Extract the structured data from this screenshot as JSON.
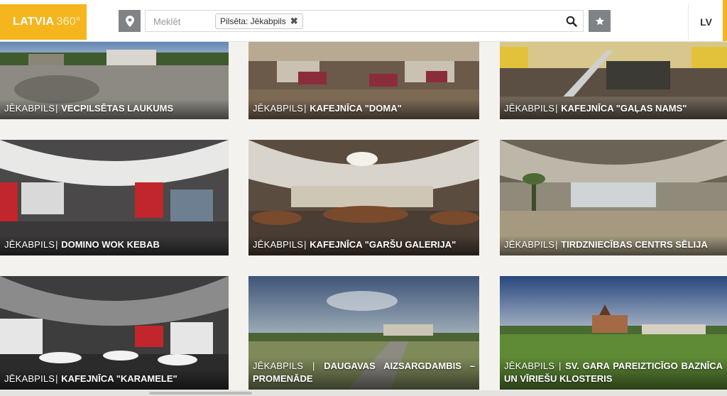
{
  "header": {
    "logo_main": "LATVIA",
    "logo_sub": "360°",
    "search_placeholder": "Meklēt",
    "filter_chip": "Pilsēta: Jēkabpils",
    "filter_remove": "✖",
    "language": "LV"
  },
  "tiles": [
    {
      "city": "JĒKABPILS",
      "place": "VECPILSĒTAS LAUKUMS"
    },
    {
      "city": "JĒKABPILS",
      "place": "KAFEJNĪCA \"DOMA\""
    },
    {
      "city": "JĒKABPILS",
      "place": "KAFEJNĪCA \"GAĻAS NAMS\""
    },
    {
      "city": "JĒKABPILS",
      "place": "DOMINO WOK KEBAB"
    },
    {
      "city": "JĒKABPILS",
      "place": "KAFEJNĪCA \"GARŠU GALERIJA\""
    },
    {
      "city": "JĒKABPILS",
      "place": "TIRDZNIECĪBAS CENTRS SĒLIJA"
    },
    {
      "city": "JĒKABPILS",
      "place": "KAFEJNĪCA \"KARAMELE\""
    },
    {
      "city": "JĒKABPILS",
      "place": "DAUGAVAS AIZSARGDAMBIS – PROMENĀDE"
    },
    {
      "city": "JĒKABPILS",
      "place": "SV. GARA PAREIZTICĪGO BAZNĪCA UN VĪRIEŠU KLOSTERIS"
    }
  ],
  "separator": "|",
  "colors": {
    "accent": "#f5b51d",
    "header_button": "#7f8386",
    "page_bg": "#f3f2ee"
  }
}
